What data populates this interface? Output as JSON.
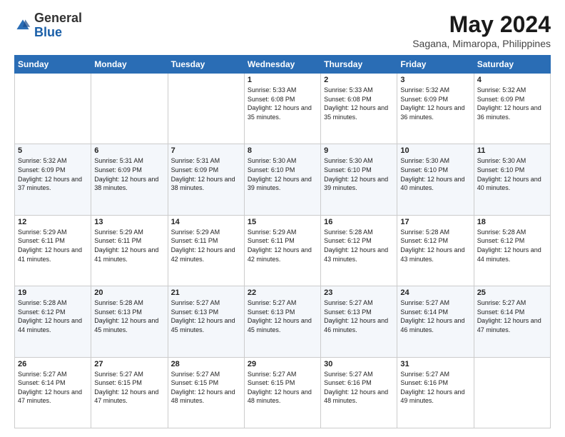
{
  "header": {
    "logo_general": "General",
    "logo_blue": "Blue",
    "title": "May 2024",
    "location": "Sagana, Mimaropa, Philippines"
  },
  "days_of_week": [
    "Sunday",
    "Monday",
    "Tuesday",
    "Wednesday",
    "Thursday",
    "Friday",
    "Saturday"
  ],
  "weeks": [
    [
      {
        "day": "",
        "info": ""
      },
      {
        "day": "",
        "info": ""
      },
      {
        "day": "",
        "info": ""
      },
      {
        "day": "1",
        "info": "Sunrise: 5:33 AM\nSunset: 6:08 PM\nDaylight: 12 hours\nand 35 minutes."
      },
      {
        "day": "2",
        "info": "Sunrise: 5:33 AM\nSunset: 6:08 PM\nDaylight: 12 hours\nand 35 minutes."
      },
      {
        "day": "3",
        "info": "Sunrise: 5:32 AM\nSunset: 6:09 PM\nDaylight: 12 hours\nand 36 minutes."
      },
      {
        "day": "4",
        "info": "Sunrise: 5:32 AM\nSunset: 6:09 PM\nDaylight: 12 hours\nand 36 minutes."
      }
    ],
    [
      {
        "day": "5",
        "info": "Sunrise: 5:32 AM\nSunset: 6:09 PM\nDaylight: 12 hours\nand 37 minutes."
      },
      {
        "day": "6",
        "info": "Sunrise: 5:31 AM\nSunset: 6:09 PM\nDaylight: 12 hours\nand 38 minutes."
      },
      {
        "day": "7",
        "info": "Sunrise: 5:31 AM\nSunset: 6:09 PM\nDaylight: 12 hours\nand 38 minutes."
      },
      {
        "day": "8",
        "info": "Sunrise: 5:30 AM\nSunset: 6:10 PM\nDaylight: 12 hours\nand 39 minutes."
      },
      {
        "day": "9",
        "info": "Sunrise: 5:30 AM\nSunset: 6:10 PM\nDaylight: 12 hours\nand 39 minutes."
      },
      {
        "day": "10",
        "info": "Sunrise: 5:30 AM\nSunset: 6:10 PM\nDaylight: 12 hours\nand 40 minutes."
      },
      {
        "day": "11",
        "info": "Sunrise: 5:30 AM\nSunset: 6:10 PM\nDaylight: 12 hours\nand 40 minutes."
      }
    ],
    [
      {
        "day": "12",
        "info": "Sunrise: 5:29 AM\nSunset: 6:11 PM\nDaylight: 12 hours\nand 41 minutes."
      },
      {
        "day": "13",
        "info": "Sunrise: 5:29 AM\nSunset: 6:11 PM\nDaylight: 12 hours\nand 41 minutes."
      },
      {
        "day": "14",
        "info": "Sunrise: 5:29 AM\nSunset: 6:11 PM\nDaylight: 12 hours\nand 42 minutes."
      },
      {
        "day": "15",
        "info": "Sunrise: 5:29 AM\nSunset: 6:11 PM\nDaylight: 12 hours\nand 42 minutes."
      },
      {
        "day": "16",
        "info": "Sunrise: 5:28 AM\nSunset: 6:12 PM\nDaylight: 12 hours\nand 43 minutes."
      },
      {
        "day": "17",
        "info": "Sunrise: 5:28 AM\nSunset: 6:12 PM\nDaylight: 12 hours\nand 43 minutes."
      },
      {
        "day": "18",
        "info": "Sunrise: 5:28 AM\nSunset: 6:12 PM\nDaylight: 12 hours\nand 44 minutes."
      }
    ],
    [
      {
        "day": "19",
        "info": "Sunrise: 5:28 AM\nSunset: 6:12 PM\nDaylight: 12 hours\nand 44 minutes."
      },
      {
        "day": "20",
        "info": "Sunrise: 5:28 AM\nSunset: 6:13 PM\nDaylight: 12 hours\nand 45 minutes."
      },
      {
        "day": "21",
        "info": "Sunrise: 5:27 AM\nSunset: 6:13 PM\nDaylight: 12 hours\nand 45 minutes."
      },
      {
        "day": "22",
        "info": "Sunrise: 5:27 AM\nSunset: 6:13 PM\nDaylight: 12 hours\nand 45 minutes."
      },
      {
        "day": "23",
        "info": "Sunrise: 5:27 AM\nSunset: 6:13 PM\nDaylight: 12 hours\nand 46 minutes."
      },
      {
        "day": "24",
        "info": "Sunrise: 5:27 AM\nSunset: 6:14 PM\nDaylight: 12 hours\nand 46 minutes."
      },
      {
        "day": "25",
        "info": "Sunrise: 5:27 AM\nSunset: 6:14 PM\nDaylight: 12 hours\nand 47 minutes."
      }
    ],
    [
      {
        "day": "26",
        "info": "Sunrise: 5:27 AM\nSunset: 6:14 PM\nDaylight: 12 hours\nand 47 minutes."
      },
      {
        "day": "27",
        "info": "Sunrise: 5:27 AM\nSunset: 6:15 PM\nDaylight: 12 hours\nand 47 minutes."
      },
      {
        "day": "28",
        "info": "Sunrise: 5:27 AM\nSunset: 6:15 PM\nDaylight: 12 hours\nand 48 minutes."
      },
      {
        "day": "29",
        "info": "Sunrise: 5:27 AM\nSunset: 6:15 PM\nDaylight: 12 hours\nand 48 minutes."
      },
      {
        "day": "30",
        "info": "Sunrise: 5:27 AM\nSunset: 6:16 PM\nDaylight: 12 hours\nand 48 minutes."
      },
      {
        "day": "31",
        "info": "Sunrise: 5:27 AM\nSunset: 6:16 PM\nDaylight: 12 hours\nand 49 minutes."
      },
      {
        "day": "",
        "info": ""
      }
    ]
  ]
}
